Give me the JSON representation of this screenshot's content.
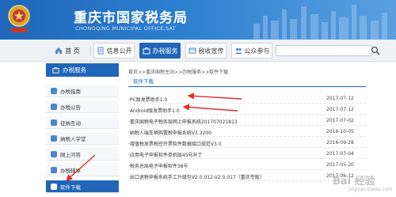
{
  "header": {
    "title": "重庆市国家税务局",
    "subtitle": "CHONGQING MUNICIPAL OFFICE,SAT"
  },
  "nav": {
    "items": [
      {
        "label": "首 页",
        "icon": "home-icon"
      },
      {
        "label": "信息公开",
        "icon": "document-icon"
      },
      {
        "label": "办税服务",
        "icon": "briefcase-icon"
      },
      {
        "label": "税收宣传",
        "icon": "megaphone-icon"
      },
      {
        "label": "公众参与",
        "icon": "people-icon"
      }
    ],
    "search": {
      "placeholder": "",
      "icon": "search-icon"
    }
  },
  "sidebar": {
    "header": "办税服务",
    "items": [
      {
        "label": "办税指南"
      },
      {
        "label": "办税公告"
      },
      {
        "label": "征纳互动"
      },
      {
        "label": "纳税人学堂"
      },
      {
        "label": "网上问答"
      },
      {
        "label": "办税辅导"
      },
      {
        "label": "软件下载"
      }
    ]
  },
  "main": {
    "breadcrumb": "首页>>重庆国税主站>>办税服务>>软件下载",
    "tab": "软件下载",
    "rows": [
      {
        "title": "·PC版发票助手1.0",
        "date": "2017-07-12"
      },
      {
        "title": "·Android版发票助手1.0",
        "date": "2017-07-12"
      },
      {
        "title": "·重庆国税电子税务局网上申报系统201707021813",
        "date": "2017-07-02"
      },
      {
        "title": "·纳税人端车辆购置税申报系统V3.3200",
        "date": "2016-10-05"
      },
      {
        "title": "·增值税发票税控开票软件数据接口规范V3.0",
        "date": "2016-09-28"
      },
      {
        "title": "·应用电子申报软件单机版45号补丁",
        "date": "2017-07-04"
      },
      {
        "title": "·税务总局电子申报软件38号",
        "date": "2017-05-20"
      },
      {
        "title": "·出口退税申报系统手工升级包V2.0.012-V2.0.017（重庆专版）",
        "date": "2017-06-12"
      }
    ]
  },
  "watermark": {
    "text": "Bai 经验",
    "sub": "jingyan.baidu.com"
  },
  "colors": {
    "primary": "#1f66b8",
    "annotation": "#e02b2b"
  }
}
